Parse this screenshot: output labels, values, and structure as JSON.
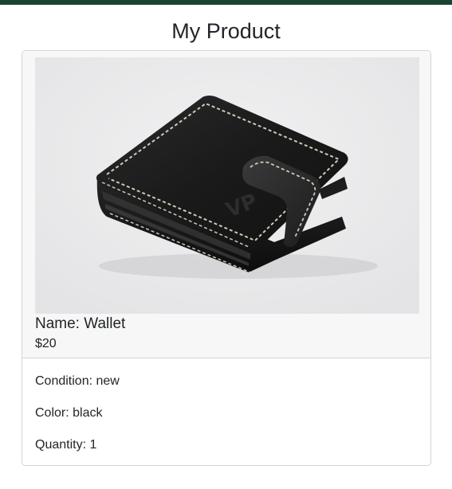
{
  "header": {
    "title": "My Product"
  },
  "product": {
    "name": "Name: Wallet",
    "price": "$20",
    "image_icon": "wallet-photo",
    "details": {
      "condition": "Condition: new",
      "color": "Color: black",
      "quantity": "Quantity: 1"
    }
  },
  "colors": {
    "top_bar": "#1b4332",
    "card_header_bg": "#f7f7f7",
    "border": "#d5d5d5"
  }
}
